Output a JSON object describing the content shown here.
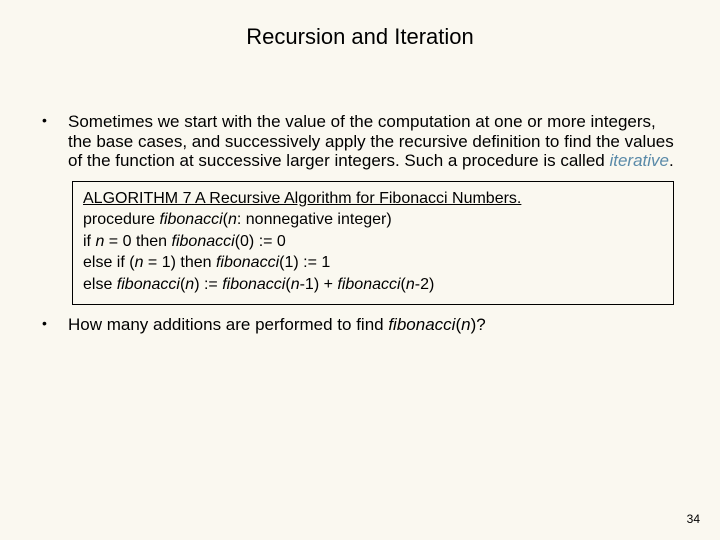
{
  "title": "Recursion and Iteration",
  "bullet1": {
    "text_pre": "Sometimes we start with the value of the computation at one or more integers, the base cases, and successively apply the recursive definition to find the values of the function at successive larger integers. Such a procedure is called ",
    "text_em": "iterative",
    "text_post": "."
  },
  "algo": {
    "header_pre": "ALGORITHM 7",
    "header_rest": "  A Recursive Algorithm for Fibonacci Numbers.",
    "line1_pre": "procedure ",
    "line1_ital": "fibonacci",
    "line1_post": "(",
    "line1_n": "n",
    "line1_rest": ": nonnegative integer)",
    "line2_pre": "if ",
    "line2_n": "n",
    "line2_mid": " = 0 then ",
    "line2_fib": "fibonacci",
    "line2_post": "(0) := 0",
    "line3_pre": "else if (",
    "line3_n": "n",
    "line3_mid": " = 1) then ",
    "line3_fib": "fibonacci",
    "line3_post": "(1) := 1",
    "line4_pre": "else ",
    "line4_fib1": "fibonacci",
    "line4_arg1a": "(",
    "line4_arg1b": "n",
    "line4_arg1c": ") := ",
    "line4_fib2": "fibonacci",
    "line4_arg2a": "(",
    "line4_arg2b": "n",
    "line4_arg2c": "-1) + ",
    "line4_fib3": "fibonacci",
    "line4_arg3a": "(",
    "line4_arg3b": "n",
    "line4_arg3c": "-2)"
  },
  "bullet2": {
    "text_pre": "How many additions are performed to find ",
    "text_ital": "fibonacci",
    "text_paren_open": "(",
    "text_n": "n",
    "text_paren_close": ")?"
  },
  "page_number": "34"
}
